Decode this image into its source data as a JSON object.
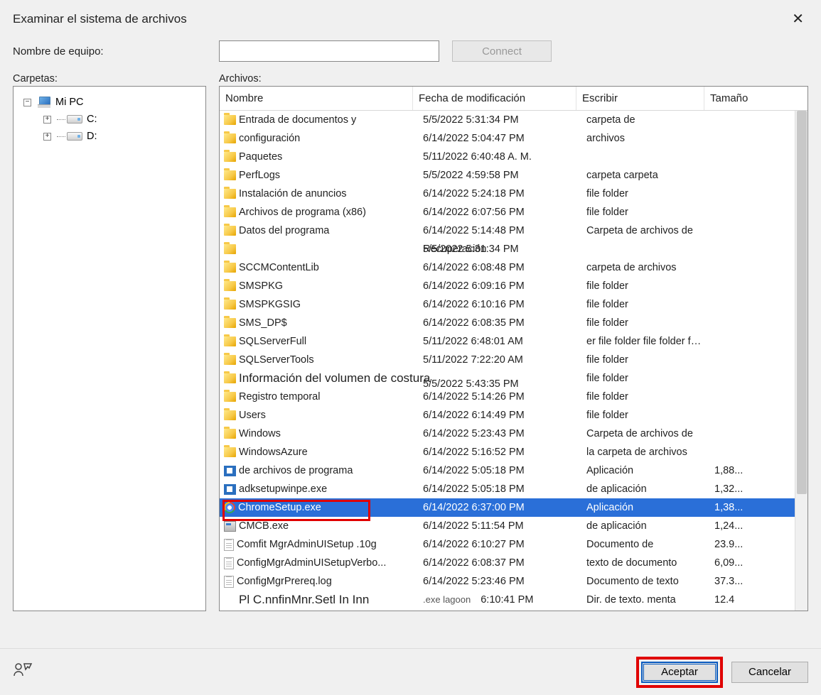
{
  "dialog": {
    "title": "Examinar el sistema de archivos",
    "computer_label": "Nombre de equipo:",
    "connect_label": "Connect",
    "folders_label": "Carpetas:",
    "files_label": "Archivos:",
    "ok_label": "Aceptar",
    "cancel_label": "Cancelar"
  },
  "tree": {
    "root": "Mi PC",
    "drives": [
      "C:",
      "D:"
    ]
  },
  "file_headers": {
    "name": "Nombre",
    "modified": "Fecha de modificación",
    "type": "Escribir",
    "size": "Tamaño"
  },
  "files": [
    {
      "icon": "folder",
      "name": "Entrada de documentos y",
      "date": "5/5/2022 5:31:34 PM",
      "type": "carpeta de",
      "size": ""
    },
    {
      "icon": "folder",
      "name": "configuración",
      "date": "6/14/2022 5:04:47 PM",
      "type": "archivos",
      "size": ""
    },
    {
      "icon": "folder",
      "name": "Paquetes",
      "date": "5/11/2022 6:40:48 A. M.",
      "type": "",
      "size": ""
    },
    {
      "icon": "folder",
      "name": "PerfLogs",
      "date": "5/5/2022 4:59:58 PM",
      "type": "carpeta carpeta",
      "size": ""
    },
    {
      "icon": "folder",
      "name": "Instalación de anuncios",
      "date": "6/14/2022 5:24:18 PM",
      "type": "file folder",
      "size": ""
    },
    {
      "icon": "folder",
      "name": "Archivos de programa (x86)",
      "date": "6/14/2022 6:07:56 PM",
      "type": "file folder",
      "size": ""
    },
    {
      "icon": "folder",
      "name": "Datos del programa",
      "date": "6/14/2022 5:14:48 PM",
      "type": "Carpeta de archivos de",
      "size": ""
    },
    {
      "icon": "folder",
      "name": "",
      "date_overlay": "5/5/2022 5:31:34 PM",
      "date": "Recuperación",
      "type": "",
      "size": "",
      "big": true
    },
    {
      "icon": "folder",
      "name": "SCCMContentLib",
      "date": "6/14/2022 6:08:48 PM",
      "type": "carpeta de archivos",
      "size": ""
    },
    {
      "icon": "folder",
      "name": "SMSPKG",
      "date": "6/14/2022 6:09:16 PM",
      "type": "file folder",
      "size": ""
    },
    {
      "icon": "folder",
      "name": "SMSPKGSIG",
      "date": "6/14/2022 6:10:16 PM",
      "type": "file folder",
      "size": ""
    },
    {
      "icon": "folder",
      "name": "SMS_DP$",
      "date": "6/14/2022 6:08:35 PM",
      "type": "file folder",
      "size": ""
    },
    {
      "icon": "folder",
      "name": "SQLServerFull",
      "date": "5/11/2022 6:48:01 AM",
      "type": "er file folder file folder file folder file folder",
      "size": ""
    },
    {
      "icon": "folder",
      "name": "SQLServerTools",
      "date": "5/11/2022 7:22:20 AM",
      "type": "file folder",
      "size": ""
    },
    {
      "icon": "folder",
      "name": "Información del volumen de costura",
      "date_overlay": "5/5/2022 5:43:35 PM",
      "date": "",
      "type": "file folder",
      "size": "",
      "big": true
    },
    {
      "icon": "folder",
      "name": "Registro temporal",
      "date": "6/14/2022 5:14:26 PM",
      "type": "file folder",
      "size": ""
    },
    {
      "icon": "folder",
      "name": "Users",
      "date": "6/14/2022 6:14:49 PM",
      "type": "file folder",
      "size": ""
    },
    {
      "icon": "folder",
      "name": "Windows",
      "date": "6/14/2022 5:23:43 PM",
      "type": "Carpeta de archivos de",
      "size": ""
    },
    {
      "icon": "folder",
      "name": "WindowsAzure",
      "date": "6/14/2022 5:16:52 PM",
      "type": "la carpeta de archivos",
      "size": ""
    },
    {
      "icon": "app",
      "name": "de archivos de programa",
      "date": "6/14/2022 5:05:18 PM",
      "type": "Aplicación",
      "size": "1,88..."
    },
    {
      "icon": "app",
      "name": "adksetupwinpe.exe",
      "date": "6/14/2022 5:05:18 PM",
      "type": "de aplicación",
      "size": "1,32..."
    },
    {
      "icon": "chrome",
      "name": "ChromeSetup.exe",
      "date": "6/14/2022 6:37:00 PM",
      "type": "Aplicación",
      "size": "1,38...",
      "selected": true,
      "frame": true
    },
    {
      "icon": "app2",
      "name": "CMCB.exe",
      "date": "6/14/2022 5:11:54 PM",
      "type": "de aplicación",
      "size": "1,24..."
    },
    {
      "icon": "doc",
      "name": "Comfit MgrAdminUISetup .10g",
      "date": "6/14/2022 6:10:27 PM",
      "type": "Documento de",
      "size": "23.9..."
    },
    {
      "icon": "doc",
      "name": "ConfigMgrAdminUISetupVerbo...",
      "date": "6/14/2022 6:08:37 PM",
      "type": "texto de documento",
      "size": "6,09..."
    },
    {
      "icon": "doc",
      "name": "ConfigMgrPrereq.log",
      "date": "6/14/2022 5:23:46 PM",
      "type": "Documento de texto",
      "size": "37.3..."
    },
    {
      "icon": "none",
      "name": "Pl C.nnfinMnr.Setl In Inn",
      "date": "6:10:41 PM",
      "type": "Dir. de texto. menta",
      "size": "12.4",
      "big": true,
      "extra": ".exe lagoon"
    }
  ]
}
